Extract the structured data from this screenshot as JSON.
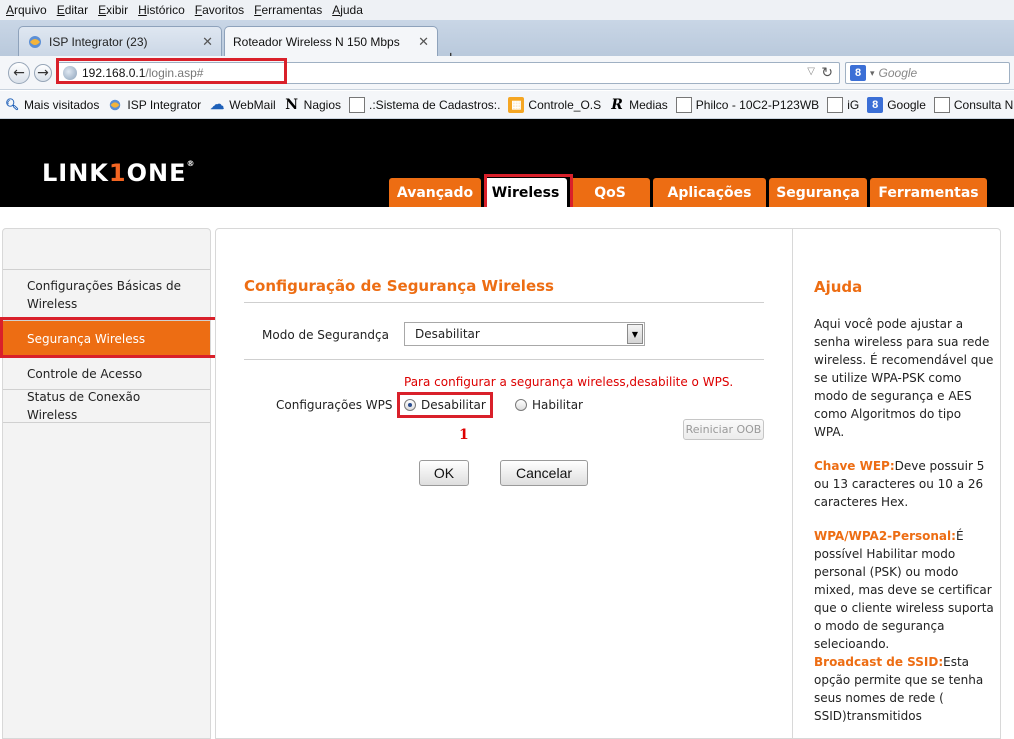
{
  "browser": {
    "menu": [
      "Arquivo",
      "Editar",
      "Exibir",
      "Histórico",
      "Favoritos",
      "Ferramentas",
      "Ajuda"
    ],
    "tabs": [
      {
        "title": "ISP Integrator (23)"
      },
      {
        "title": "Roteador Wireless N 150 Mbps"
      }
    ],
    "url_host": "192.168.0.1",
    "url_path": "/login.asp#",
    "search_placeholder": "Google",
    "bookmarks": [
      "Mais visitados",
      "ISP Integrator",
      "WebMail",
      "Nagios",
      ".:Sistema de Cadastros:.",
      "Controle_O.S",
      "Medias",
      "Philco - 10C2-P123WB",
      "iG",
      "Google",
      "Consulta Núme"
    ]
  },
  "router": {
    "logo_left": "LINK",
    "logo_mid": "1",
    "logo_right": "ONE",
    "nav_tabs": [
      "Avançado",
      "Wireless",
      "QoS",
      "Aplicações",
      "Segurança",
      "Ferramentas"
    ],
    "sidebar": [
      "Configurações Básicas de Wireless",
      "Segurança Wireless",
      "Controle de Acesso",
      "Status de Conexão Wireless"
    ],
    "main": {
      "title": "Configuração de Segurança Wireless",
      "mode_label": "Modo de Segurandça",
      "mode_value": "Desabilitar",
      "wps_warning": "Para configurar a segurança wireless,desabilite o WPS.",
      "wps_label": "Configurações WPS",
      "wps_opt_disable": "Desabilitar",
      "wps_opt_enable": "Habilitar",
      "annotation": "1",
      "reset_oob": "Reiniciar OOB",
      "ok": "OK",
      "cancel": "Cancelar"
    },
    "help": {
      "title": "Ajuda",
      "p1": "Aqui você pode ajustar a senha wireless para sua rede wireless. É recomendável que se utilize WPA-PSK como modo de segurança e AES como Algoritmos do tipo WPA.",
      "p2_key": "Chave WEP:",
      "p2": "Deve possuir 5 ou 13 caracteres ou 10 a 26 caracteres Hex.",
      "p3_key": "WPA/WPA2-Personal:",
      "p3": "É possível Habilitar modo personal (PSK) ou modo mixed, mas deve se certificar que o cliente wireless suporta o modo de segurança selecioando.",
      "p4_key": "Broadcast de SSID:",
      "p4": "Esta opção permite que se tenha seus nomes de rede ( SSID)transmitidos"
    }
  },
  "colors": {
    "accent": "#ed6d13",
    "highlight": "#d9202a",
    "warning": "#dd0000"
  }
}
